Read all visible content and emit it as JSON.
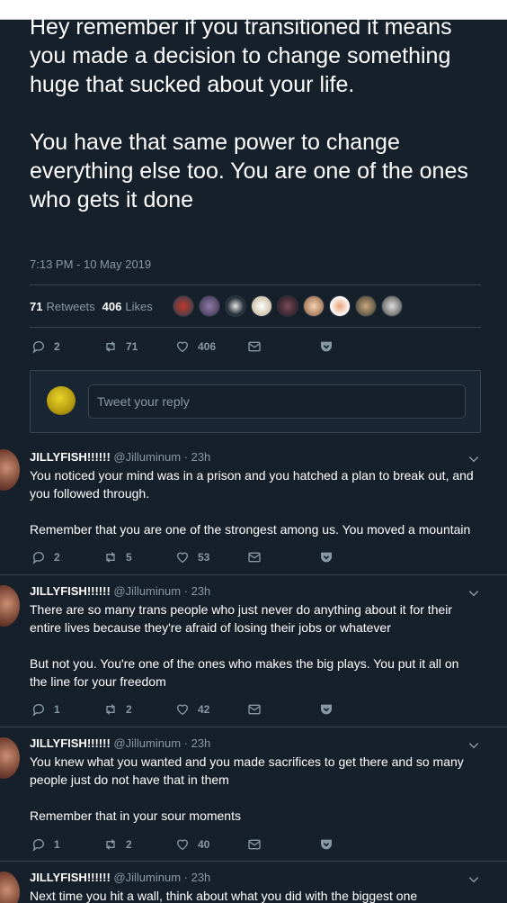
{
  "main_tweet": {
    "paragraphs": [
      "Hey remember if you transitioned it means you made a decision to change something huge that sucked about your life.",
      "You have that same power to change everything else too.  You are one of the ones who gets it done"
    ],
    "timestamp": "7:13 PM - 10 May 2019",
    "retweets_count": "71",
    "retweets_label": "Retweets",
    "likes_count": "406",
    "likes_label": "Likes",
    "actions": {
      "reply": "2",
      "retweet": "71",
      "like": "406"
    }
  },
  "reply_box": {
    "placeholder": "Tweet your reply"
  },
  "replies": [
    {
      "name": "JILLYFISH!!!!!!",
      "handle": "@Jilluminum",
      "time": "23h",
      "lines": [
        "You noticed your mind was in a prison and you hatched a plan to break out, and you followed through.",
        "Remember that you are one of the strongest among us.  You moved a mountain"
      ],
      "actions": {
        "reply": "2",
        "retweet": "5",
        "like": "53"
      }
    },
    {
      "name": "JILLYFISH!!!!!!",
      "handle": "@Jilluminum",
      "time": "23h",
      "lines": [
        "There are so many trans people who just never do anything about it for their entire lives because they're afraid of losing their jobs or whatever",
        "But not you.  You're one of the ones who makes the big plays. You put it all on the line for your freedom"
      ],
      "actions": {
        "reply": "1",
        "retweet": "2",
        "like": "42"
      }
    },
    {
      "name": "JILLYFISH!!!!!!",
      "handle": "@Jilluminum",
      "time": "23h",
      "lines": [
        "You knew what you wanted and you made sacrifices to get there and so many people just do not have that in them",
        "Remember that in your sour moments"
      ],
      "actions": {
        "reply": "1",
        "retweet": "2",
        "like": "40"
      }
    },
    {
      "name": "JILLYFISH!!!!!!",
      "handle": "@Jilluminum",
      "time": "23h",
      "lines": [
        "Next time you hit a wall, think about what you did with the biggest one"
      ]
    }
  ],
  "colors": {
    "background": "#15202b",
    "muted": "#8899a6",
    "border": "#38444d"
  }
}
